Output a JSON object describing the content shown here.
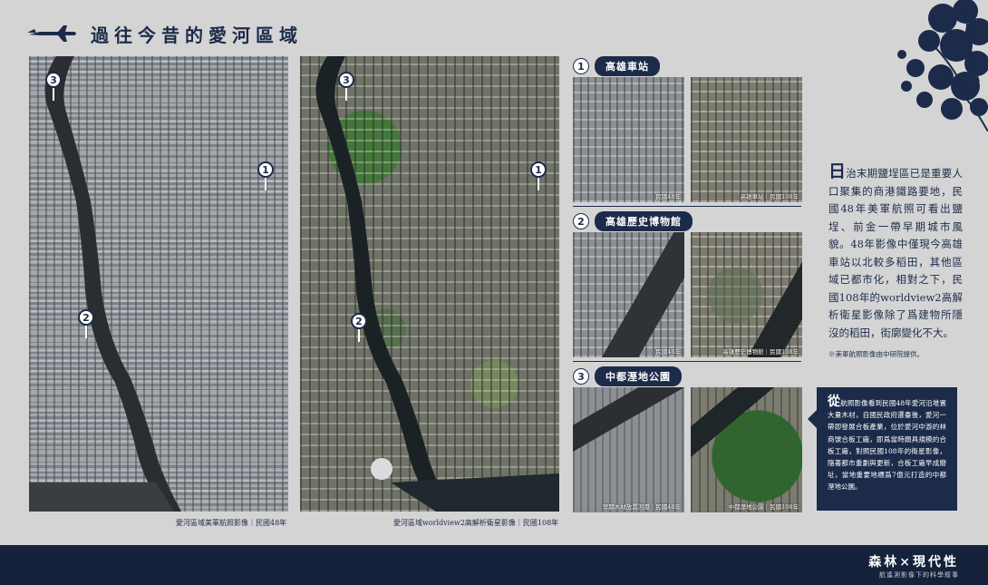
{
  "header": {
    "title": "過往今昔的愛河區域"
  },
  "maps": {
    "left_caption": "愛河區域美軍航照影像｜民國48年",
    "right_caption": "愛河區域worldview2高解析衛星影像｜民國108年",
    "markers": [
      "1",
      "2",
      "3"
    ]
  },
  "sections": [
    {
      "num": "1",
      "label": "高雄車站",
      "old_caption": "民國48年",
      "new_caption": "高雄車站｜民國108年"
    },
    {
      "num": "2",
      "label": "高雄歷史博物館",
      "old_caption": "民國48年",
      "new_caption": "高雄歷史博物館｜民國108年"
    },
    {
      "num": "3",
      "label": "中都溼地公園",
      "old_caption": "早期木材放置河港｜民國48年",
      "new_caption": "中都溼地公園｜民國108年"
    }
  ],
  "paragraph": {
    "dropcap": "日",
    "text": "治末期鹽埕區已是重要人口聚集的商港鐵路要地，民國48年美軍航照可看出鹽埕、前金一帶早期城市風貌。48年影像中僅現今高雄車站以北較多稻田，其他區域已都市化，相對之下，民國108年的worldview2高解析衛星影像除了爲建物所隱沒的稻田，街廓變化不大。"
  },
  "note": "※美軍航照影像由中研院提供。",
  "box": {
    "dropcap": "從",
    "text": "航照影像看到民國48年愛河沿堆置大量木材，自國民政府遷臺後，愛河一帶即發展合板產業，位於愛河中游的林商號合板工廠，即爲當時頗具規模的合板工廠，對照民國108年的衛星影像，隨著都市重劃與更新，合板工廠早成廢址，當地重要地標爲7億元打造的中都溼地公園。"
  },
  "footer": {
    "title": "森林×現代性",
    "subtitle": "航遙測影像下的科學叙事"
  },
  "colors": {
    "navy": "#1c2b4a",
    "background": "#d4d4d4",
    "footer": "#16223c"
  }
}
